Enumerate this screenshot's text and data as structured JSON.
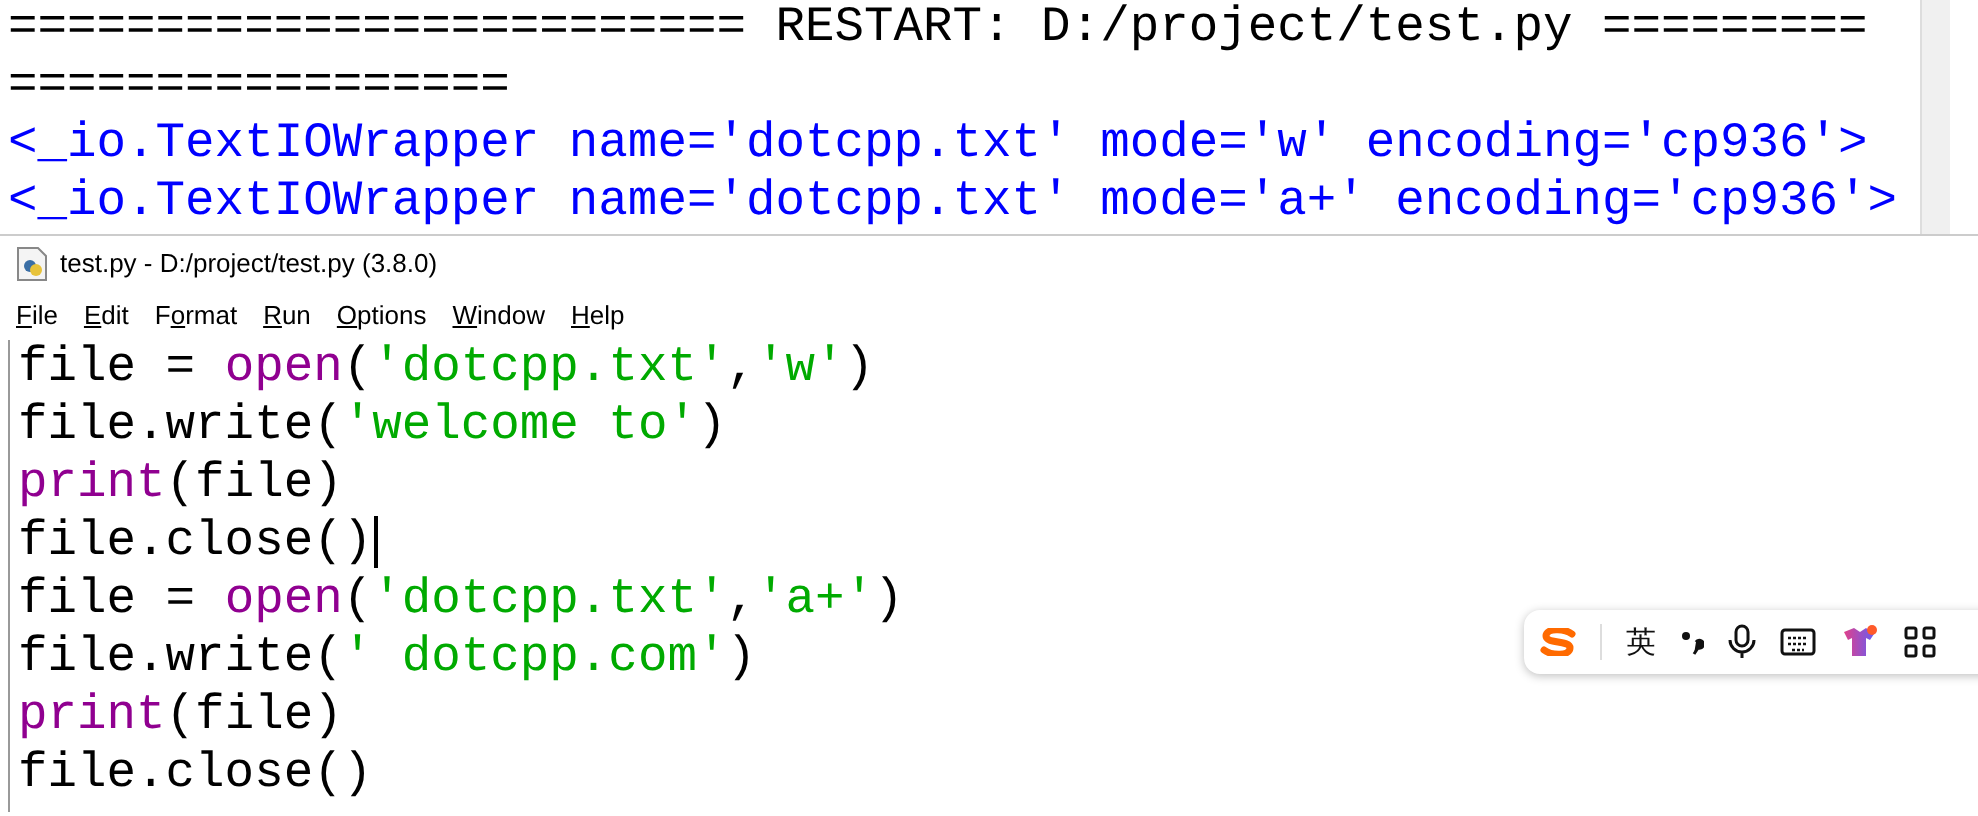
{
  "shell": {
    "restart_line": "========================= RESTART: D:/project/test.py =========",
    "restart_wrap": "=================",
    "output": [
      "<_io.TextIOWrapper name='dotcpp.txt' mode='w' encoding='cp936'>",
      "<_io.TextIOWrapper name='dotcpp.txt' mode='a+' encoding='cp936'>"
    ]
  },
  "editor": {
    "title": "test.py - D:/project/test.py (3.8.0)",
    "menu": [
      {
        "key": "F",
        "post": "ile"
      },
      {
        "key": "E",
        "post": "dit"
      },
      {
        "pre": "F",
        "key": "o",
        "post": "rmat"
      },
      {
        "key": "R",
        "post": "un"
      },
      {
        "key": "O",
        "post": "ptions"
      },
      {
        "key": "W",
        "post": "indow"
      },
      {
        "key": "H",
        "post": "elp"
      }
    ],
    "lines": [
      {
        "cursor": false,
        "tokens": [
          {
            "kind": "plain",
            "text": "file = "
          },
          {
            "kind": "builtin",
            "text": "open"
          },
          {
            "kind": "plain",
            "text": "("
          },
          {
            "kind": "string",
            "text": "'dotcpp.txt'"
          },
          {
            "kind": "plain",
            "text": ","
          },
          {
            "kind": "string",
            "text": "'w'"
          },
          {
            "kind": "plain",
            "text": ")"
          }
        ]
      },
      {
        "cursor": false,
        "tokens": [
          {
            "kind": "plain",
            "text": "file.write("
          },
          {
            "kind": "string",
            "text": "'welcome to'"
          },
          {
            "kind": "plain",
            "text": ")"
          }
        ]
      },
      {
        "cursor": false,
        "tokens": [
          {
            "kind": "builtin",
            "text": "print"
          },
          {
            "kind": "plain",
            "text": "(file)"
          }
        ]
      },
      {
        "cursor": true,
        "tokens": [
          {
            "kind": "plain",
            "text": "file.close()"
          }
        ]
      },
      {
        "cursor": false,
        "tokens": [
          {
            "kind": "plain",
            "text": "file = "
          },
          {
            "kind": "builtin",
            "text": "open"
          },
          {
            "kind": "plain",
            "text": "("
          },
          {
            "kind": "string",
            "text": "'dotcpp.txt'"
          },
          {
            "kind": "plain",
            "text": ","
          },
          {
            "kind": "string",
            "text": "'a+'"
          },
          {
            "kind": "plain",
            "text": ")"
          }
        ]
      },
      {
        "cursor": false,
        "tokens": [
          {
            "kind": "plain",
            "text": "file.write("
          },
          {
            "kind": "string",
            "text": "' dotcpp.com'"
          },
          {
            "kind": "plain",
            "text": ")"
          }
        ]
      },
      {
        "cursor": false,
        "tokens": [
          {
            "kind": "builtin",
            "text": "print"
          },
          {
            "kind": "plain",
            "text": "(file)"
          }
        ]
      },
      {
        "cursor": false,
        "tokens": [
          {
            "kind": "plain",
            "text": "file.close()"
          }
        ]
      }
    ]
  },
  "ime_toolbar": {
    "mode": "英"
  }
}
